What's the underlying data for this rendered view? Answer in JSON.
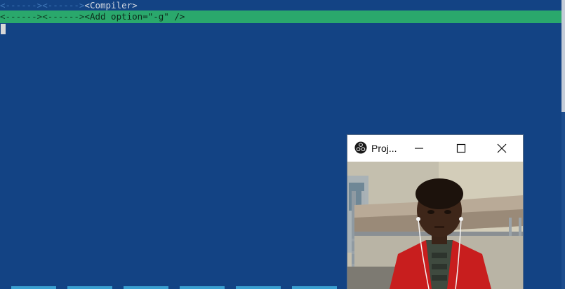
{
  "terminal": {
    "line1": {
      "guides": "<------><------>",
      "text": "<Compiler>"
    },
    "line2": {
      "guides": "<------><------>",
      "text": "<Add option=\"-g\" />"
    }
  },
  "projector": {
    "title": "Proj...",
    "icon": "obs-logo-icon"
  },
  "colors": {
    "background": "#134384",
    "highlight": "#2aa86c",
    "guide": "#3f77b8"
  }
}
